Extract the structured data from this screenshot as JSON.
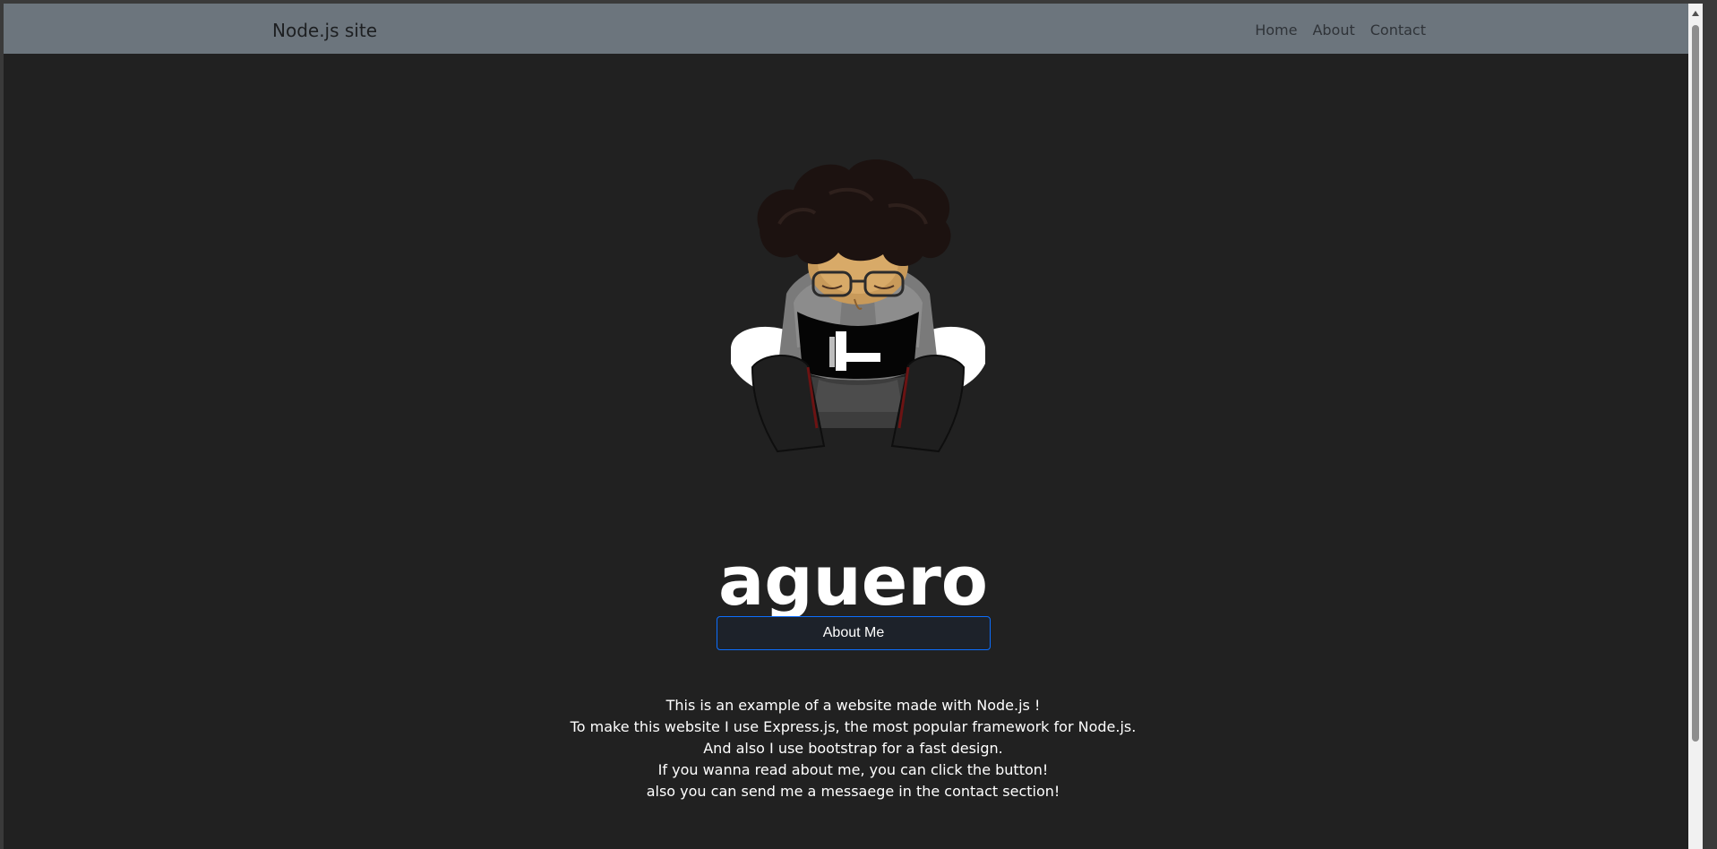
{
  "navbar": {
    "brand": "Node.js site",
    "links": [
      {
        "label": "Home"
      },
      {
        "label": "About"
      },
      {
        "label": "Contact"
      }
    ]
  },
  "hero": {
    "title": "aguero",
    "about_button": "About Me",
    "intro_lines": [
      "This is an example of a website made with Node.js !",
      "To make this website I use Express.js, the most popular framework for Node.js.",
      "And also I use bootstrap for a fast design.",
      "If you wanna read about me, you can click the button!",
      "also you can send me a messaege in the contact section!"
    ]
  },
  "colors": {
    "page_background": "#212121",
    "navbar_background": "#6c757d",
    "button_border": "#0d6efd",
    "text": "#ffffff"
  }
}
